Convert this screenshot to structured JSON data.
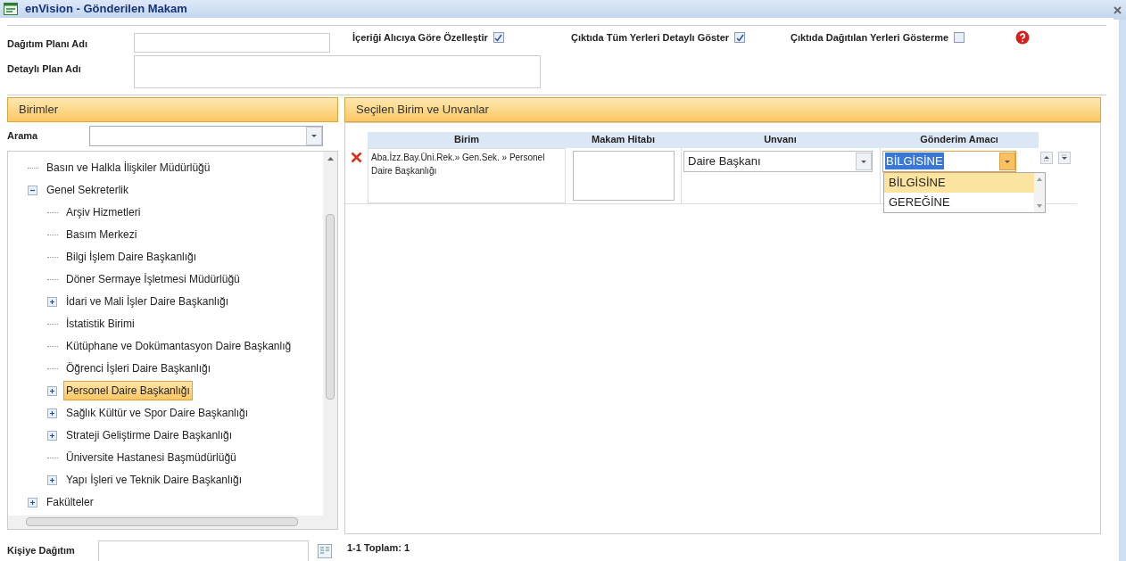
{
  "window": {
    "title": "enVision - Gönderilen Makam"
  },
  "form": {
    "plan_name": {
      "label": "Dağıtım Planı Adı"
    },
    "detail_name": {
      "label": "Detaylı Plan Adı"
    },
    "options": [
      {
        "label": "İçeriği Alıcıya Göre Özelleştir",
        "checked": true
      },
      {
        "label": "Çıktıda Tüm Yerleri Detaylı Göster",
        "checked": true
      },
      {
        "label": "Çıktıda Dağıtılan Yerleri Gösterme",
        "checked": false
      }
    ]
  },
  "units_panel": {
    "title": "Birimler",
    "search": {
      "label": "Arama"
    },
    "tree": [
      {
        "label": "Basın ve Halkla İlişkiler Müdürlüğü",
        "kind": "leaf",
        "selected": false
      },
      {
        "label": "Genel Sekreterlik",
        "kind": "folder",
        "expanded": true,
        "selected": false,
        "children": [
          {
            "label": "Arşiv Hizmetleri",
            "kind": "leaf",
            "selected": false
          },
          {
            "label": "Basım Merkezi",
            "kind": "leaf",
            "selected": false
          },
          {
            "label": "Bilgi İşlem Daire Başkanlığı",
            "kind": "leaf",
            "selected": false
          },
          {
            "label": "Döner Sermaye İşletmesi Müdürlüğü",
            "kind": "leaf",
            "selected": false
          },
          {
            "label": "İdari ve Mali İşler Daire Başkanlığı",
            "kind": "folder",
            "expanded": false,
            "selected": false
          },
          {
            "label": "İstatistik Birimi",
            "kind": "leaf",
            "selected": false
          },
          {
            "label": "Kütüphane ve Dokümantasyon Daire Başkanlığ",
            "kind": "leaf",
            "selected": false
          },
          {
            "label": "Öğrenci İşleri Daire Başkanlığı",
            "kind": "leaf",
            "selected": false
          },
          {
            "label": "Personel Daire Başkanlığı",
            "kind": "folder",
            "expanded": false,
            "selected": true
          },
          {
            "label": "Sağlık Kültür ve Spor Daire Başkanlığı",
            "kind": "folder",
            "expanded": false,
            "selected": false
          },
          {
            "label": "Strateji Geliştirme Daire Başkanlığı",
            "kind": "folder",
            "expanded": false,
            "selected": false
          },
          {
            "label": "Üniversite Hastanesi Başmüdürlüğü",
            "kind": "leaf",
            "selected": false
          },
          {
            "label": "Yapı İşleri ve Teknik Daire Başkanlığı",
            "kind": "folder",
            "expanded": false,
            "selected": false
          }
        ]
      },
      {
        "label": "Fakülteler",
        "kind": "folder",
        "expanded": false,
        "selected": false
      }
    ],
    "person": {
      "label": "Kişiye Dağıtım"
    }
  },
  "selected_panel": {
    "title": "Seçilen Birim ve Unvanlar",
    "columns": [
      "Birim",
      "Makam Hitabı",
      "Unvanı",
      "Gönderim Amacı"
    ],
    "rows": [
      {
        "birim": "Aba.İzz.Bay.Üni.Rek.» Gen.Sek. » Personel Daire Başkanlığı",
        "unvani": "Daire Başkanı",
        "gonderim_amaci": "BİLGİSİNE",
        "purpose_options": [
          {
            "label": "BİLGİSİNE",
            "selected": true
          },
          {
            "label": "GEREĞİNE",
            "selected": false
          }
        ]
      }
    ],
    "footer": "1-1 Toplam: 1"
  }
}
